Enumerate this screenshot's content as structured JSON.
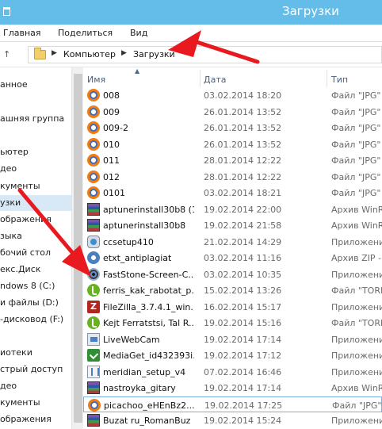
{
  "window": {
    "title": "Загрузки"
  },
  "ribbon": {
    "tabs": [
      "Главная",
      "Поделиться",
      "Вид"
    ]
  },
  "address": {
    "crumbs": [
      "Компьютер",
      "Загрузки"
    ]
  },
  "columns": {
    "name": "Имя",
    "date": "Дата",
    "type": "Тип"
  },
  "sidebar": {
    "items": [
      {
        "label": "анное"
      },
      {
        "label": "ашняя группа"
      },
      {
        "label": "ьютер"
      },
      {
        "label": "део"
      },
      {
        "label": "кументы"
      },
      {
        "label": "узки"
      },
      {
        "label": "ображения"
      },
      {
        "label": "зыка"
      },
      {
        "label": "бочий стол"
      },
      {
        "label": "екс.Диск"
      },
      {
        "label": "ndows 8 (C:)"
      },
      {
        "label": "и файлы (D:)"
      },
      {
        "label": "-дисковод (F:)"
      },
      {
        "label": "иотеки"
      },
      {
        "label": "стрый доступ"
      },
      {
        "label": "део"
      },
      {
        "label": "кументы"
      },
      {
        "label": "ображения"
      }
    ],
    "selected_index": 5
  },
  "files": [
    {
      "name": "008",
      "date": "03.02.2014 18:20",
      "type": "Файл \"JPG\"",
      "icon": "jpg-file-icon"
    },
    {
      "name": "009",
      "date": "26.01.2014 13:52",
      "type": "Файл \"JPG\"",
      "icon": "jpg-file-icon"
    },
    {
      "name": "009-2",
      "date": "26.01.2014 13:52",
      "type": "Файл \"JPG\"",
      "icon": "jpg-file-icon"
    },
    {
      "name": "010",
      "date": "26.01.2014 13:52",
      "type": "Файл \"JPG\"",
      "icon": "jpg-file-icon"
    },
    {
      "name": "011",
      "date": "28.01.2014 12:22",
      "type": "Файл \"JPG\"",
      "icon": "jpg-file-icon"
    },
    {
      "name": "012",
      "date": "28.01.2014 12:22",
      "type": "Файл \"JPG\"",
      "icon": "jpg-file-icon"
    },
    {
      "name": "0101",
      "date": "03.02.2014 18:21",
      "type": "Файл \"JPG\"",
      "icon": "jpg-file-icon"
    },
    {
      "name": "aptunerinstall30b8 (1)",
      "date": "19.02.2014 22:00",
      "type": "Архив WinR",
      "icon": "winrar-archive-icon"
    },
    {
      "name": "aptunerinstall30b8",
      "date": "19.02.2014 21:58",
      "type": "Архив WinR",
      "icon": "winrar-archive-icon"
    },
    {
      "name": "ccsetup410",
      "date": "21.02.2014 14:29",
      "type": "Приложени",
      "icon": "ccleaner-icon"
    },
    {
      "name": "etxt_antiplagiat",
      "date": "03.02.2014 11:16",
      "type": "Архив ZIP -",
      "icon": "zip-archive-icon"
    },
    {
      "name": "FastStone-Screen-C...",
      "date": "03.02.2014 10:35",
      "type": "Приложени",
      "icon": "faststone-icon"
    },
    {
      "name": "ferris_kak_rabotat_p...",
      "date": "15.02.2014 13:26",
      "type": "Файл \"TORF",
      "icon": "torrent-icon"
    },
    {
      "name": "FileZilla_3.7.4.1_win...",
      "date": "16.02.2014 15:17",
      "type": "Приложени",
      "icon": "filezilla-icon"
    },
    {
      "name": "Kejt Ferratstsi, Tal R...",
      "date": "19.02.2014 15:16",
      "type": "Файл \"TORF",
      "icon": "torrent-icon"
    },
    {
      "name": "LiveWebCam",
      "date": "19.02.2014 17:14",
      "type": "Приложени",
      "icon": "livewebcam-icon"
    },
    {
      "name": "MediaGet_id432393i...",
      "date": "19.02.2014 17:12",
      "type": "Приложени",
      "icon": "mediaget-icon"
    },
    {
      "name": "meridian_setup_v4",
      "date": "07.02.2014 16:46",
      "type": "Приложени",
      "icon": "meridian-icon"
    },
    {
      "name": "nastroyka_gitary",
      "date": "19.02.2014 17:14",
      "type": "Архив WinR",
      "icon": "winrar-archive-icon"
    },
    {
      "name": "picachoo_eHEnBz2...",
      "date": "19.02.2014 17:25",
      "type": "Файл \"JPG\"",
      "icon": "jpg-file-icon"
    },
    {
      "name": "Buzat ru_RomanBuz",
      "date": "19.02.2014 15:24",
      "type": "Приложени",
      "icon": "winrar-archive-icon"
    }
  ],
  "selected_file_index": 19,
  "colors": {
    "titlebar": "#63bde8",
    "selection": "#d7e9f7",
    "annotation_arrow": "#e8191f"
  }
}
